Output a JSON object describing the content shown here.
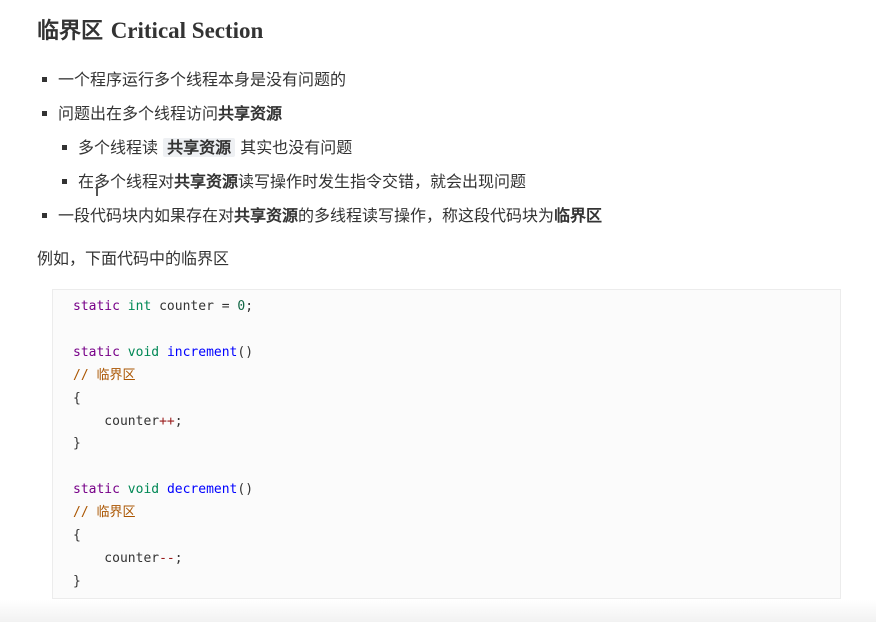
{
  "heading": {
    "zh": "临界区",
    "en": "Critical Section"
  },
  "bullets": [
    {
      "text": "一个程序运行多个线程本身是没有问题的"
    },
    {
      "pre": "问题出在多个线程访问",
      "bold": "共享资源",
      "post": ""
    },
    {
      "pre": "多个线程读 ",
      "bold": "共享资源",
      "post": " 其实也没有问题"
    },
    {
      "pre": "在多个线程对",
      "bold": "共享资源",
      "post": "读写操作时发生指令交错，就会出现问题"
    },
    {
      "pre": "一段代码块内如果存在对",
      "bold": "共享资源",
      "mid": "的多线程读写操作，称这段代码块为",
      "bold2": "临界区"
    }
  ],
  "paragraph": "例如，下面代码中的临界区",
  "code": {
    "kw_static": "static",
    "ty_int": "int",
    "ty_void": "void",
    "var_counter": "counter",
    "eq": " = ",
    "zero": "0",
    "semi": ";",
    "fn_increment": "increment",
    "fn_decrement": "decrement",
    "parens": "()",
    "comment": "// 临界区",
    "open_brace": "{",
    "close_brace": "}",
    "indent_counter": "    counter",
    "op_inc": "++",
    "op_dec": "--"
  }
}
